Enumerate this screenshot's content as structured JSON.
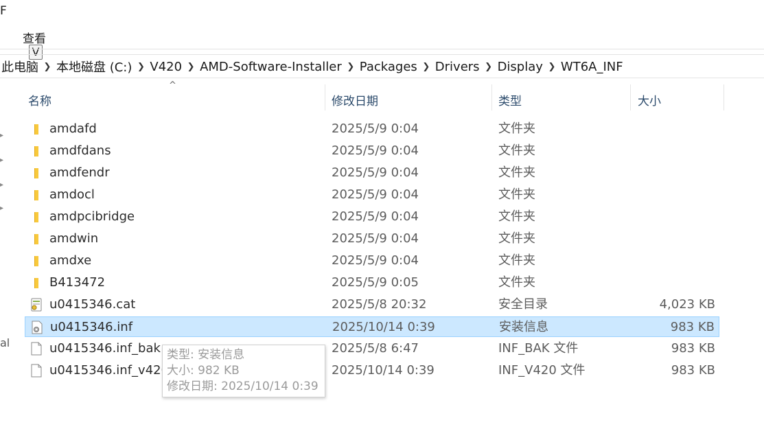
{
  "menu_fragment": "F",
  "ribbon": {
    "view_tab": "查看",
    "key_hint": "V"
  },
  "breadcrumb": [
    "此电脑",
    "本地磁盘 (C:)",
    "V420",
    "AMD-Software-Installer",
    "Packages",
    "Drivers",
    "Display",
    "WT6A_INF"
  ],
  "columns": {
    "name": "名称",
    "date": "修改日期",
    "type": "类型",
    "size": "大小"
  },
  "rows": [
    {
      "icon": "folder-icon",
      "name": "amdafd",
      "date": "2025/5/9 0:04",
      "type": "文件夹",
      "size": ""
    },
    {
      "icon": "folder-icon",
      "name": "amdfdans",
      "date": "2025/5/9 0:04",
      "type": "文件夹",
      "size": ""
    },
    {
      "icon": "folder-icon",
      "name": "amdfendr",
      "date": "2025/5/9 0:04",
      "type": "文件夹",
      "size": ""
    },
    {
      "icon": "folder-icon",
      "name": "amdocl",
      "date": "2025/5/9 0:04",
      "type": "文件夹",
      "size": ""
    },
    {
      "icon": "folder-icon",
      "name": "amdpcibridge",
      "date": "2025/5/9 0:04",
      "type": "文件夹",
      "size": ""
    },
    {
      "icon": "folder-icon",
      "name": "amdwin",
      "date": "2025/5/9 0:04",
      "type": "文件夹",
      "size": ""
    },
    {
      "icon": "folder-icon",
      "name": "amdxe",
      "date": "2025/5/9 0:04",
      "type": "文件夹",
      "size": ""
    },
    {
      "icon": "folder-icon",
      "name": "B413472",
      "date": "2025/5/9 0:05",
      "type": "文件夹",
      "size": ""
    },
    {
      "icon": "security-catalog-icon",
      "name": "u0415346.cat",
      "date": "2025/5/8 20:32",
      "type": "安全目录",
      "size": "4,023 KB"
    },
    {
      "icon": "setup-info-file-icon",
      "name": "u0415346.inf",
      "date": "2025/10/14 0:39",
      "type": "安装信息",
      "size": "983 KB",
      "selected": true
    },
    {
      "icon": "blank-file-icon",
      "name": "u0415346.inf_bak",
      "date": "2025/5/8 6:47",
      "type": "INF_BAK 文件",
      "size": "983 KB"
    },
    {
      "icon": "blank-file-icon",
      "name": "u0415346.inf_v420",
      "date": "2025/10/14 0:39",
      "type": "INF_V420 文件",
      "size": "983 KB"
    }
  ],
  "tooltip": {
    "type_line": "类型: 安装信息",
    "size_line": "大小: 982 KB",
    "date_line": "修改日期: 2025/10/14 0:39"
  },
  "left_fragment": "al",
  "colors": {
    "selection_bg": "#cce8ff",
    "selection_border": "#99d1ff",
    "folder": "#f8c93c",
    "header_text": "#2b4a6b"
  }
}
